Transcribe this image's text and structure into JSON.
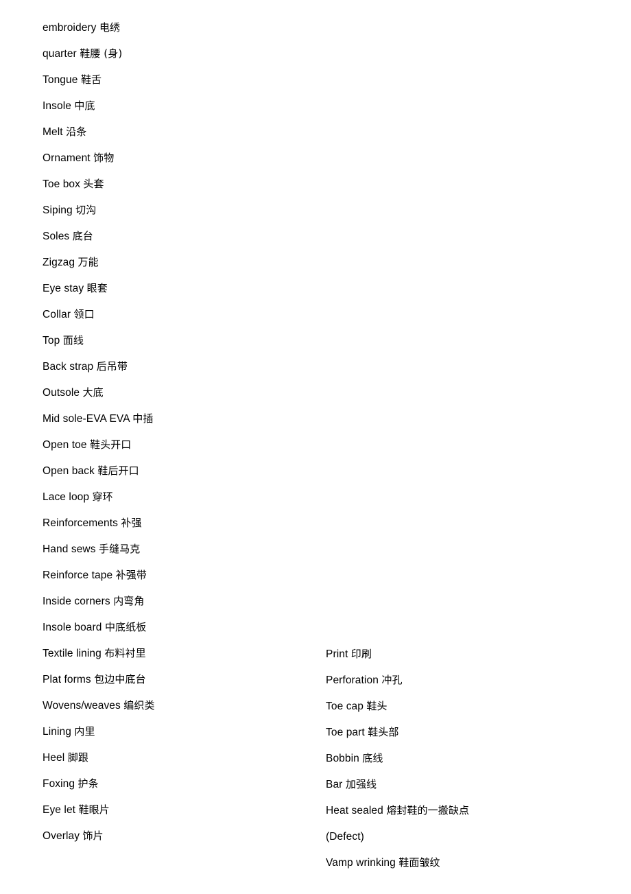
{
  "document": {
    "type": "glossary",
    "page_background": "#ffffff",
    "text_color": "#000000",
    "columns": [
      {
        "id": "left",
        "entries": [
          {
            "en": "embroidery",
            "zh": "电绣"
          },
          {
            "en": "quarter",
            "zh": "鞋腰 (身)"
          },
          {
            "en": "Tongue",
            "zh": "鞋舌"
          },
          {
            "en": "Insole",
            "zh": "中底"
          },
          {
            "en": "Melt",
            "zh": "沿条"
          },
          {
            "en": "Ornament",
            "zh": "饰物"
          },
          {
            "en": "Toe box",
            "zh": "头套"
          },
          {
            "en": "Siping",
            "zh": "切沟"
          },
          {
            "en": "Soles",
            "zh": "底台"
          },
          {
            "en": "Zigzag",
            "zh": "万能"
          },
          {
            "en": "Eye stay",
            "zh": "眼套"
          },
          {
            "en": "Collar",
            "zh": "领口"
          },
          {
            "en": "Top",
            "zh": "面线"
          },
          {
            "en": "Back strap",
            "zh": "后吊带"
          },
          {
            "en": "Outsole",
            "zh": "大底"
          },
          {
            "en": "Mid sole-EVA EVA",
            "zh": "中插"
          },
          {
            "en": "Open toe",
            "zh": "鞋头开口"
          },
          {
            "en": "Open back",
            "zh": "鞋后开口"
          },
          {
            "en": "Lace loop",
            "zh": "穿环"
          },
          {
            "en": "Reinforcements",
            "zh": "补强"
          },
          {
            "en": "Hand sews",
            "zh": "手缝马克"
          },
          {
            "en": "Reinforce tape",
            "zh": "补强带"
          },
          {
            "en": "Inside corners",
            "zh": "内弯角"
          },
          {
            "en": "Insole board",
            "zh": "中底纸板"
          },
          {
            "en": "Textile lining",
            "zh": "布料衬里"
          },
          {
            "en": "Plat forms",
            "zh": "包边中底台"
          },
          {
            "en": "Wovens/weaves",
            "zh": "编织类"
          },
          {
            "en": "Lining",
            "zh": "内里"
          },
          {
            "en": "Heel",
            "zh": "脚跟"
          },
          {
            "en": "Foxing",
            "zh": "护条"
          },
          {
            "en": "Eye let",
            "zh": "鞋眼片"
          },
          {
            "en": "Overlay",
            "zh": "饰片"
          }
        ]
      },
      {
        "id": "right",
        "entries": [
          {
            "en": "Print",
            "zh": "印刷"
          },
          {
            "en": "Perforation",
            "zh": "冲孔"
          },
          {
            "en": "Toe cap",
            "zh": "鞋头"
          },
          {
            "en": "Toe part",
            "zh": "鞋头部"
          },
          {
            "en": "Bobbin",
            "zh": "底线"
          },
          {
            "en": "Bar",
            "zh": "加强线"
          },
          {
            "en": "Heat sealed",
            "zh": "熔封鞋的一搬缺点"
          },
          {
            "en": "(Defect)",
            "zh": ""
          },
          {
            "en": "Vamp wrinking",
            "zh": "鞋面皱纹"
          }
        ]
      }
    ]
  }
}
